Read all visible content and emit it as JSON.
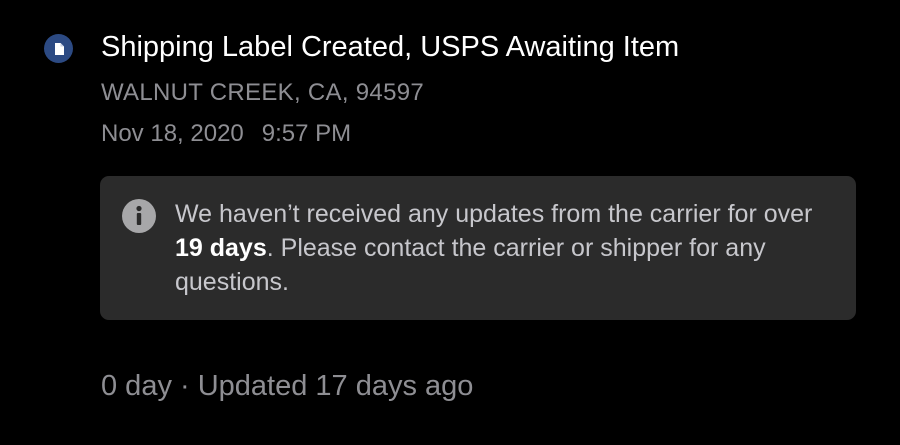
{
  "event": {
    "status_icon": "document-icon",
    "title": "Shipping Label Created, USPS Awaiting Item",
    "location": "WALNUT CREEK, CA, 94597",
    "date": "Nov 18, 2020",
    "time": "9:57 PM"
  },
  "notice": {
    "icon": "info-icon",
    "text_before": "We haven’t received any updates from the carrier for over ",
    "highlight": "19 days",
    "text_after": ". Please contact the carrier or shipper for any questions."
  },
  "footer": {
    "text": "0 day · Updated 17 days ago"
  },
  "colors": {
    "background": "#000000",
    "status_dot": "#2c4a83",
    "notice_background": "#2b2b2b",
    "secondary_text": "#8e8e93"
  }
}
